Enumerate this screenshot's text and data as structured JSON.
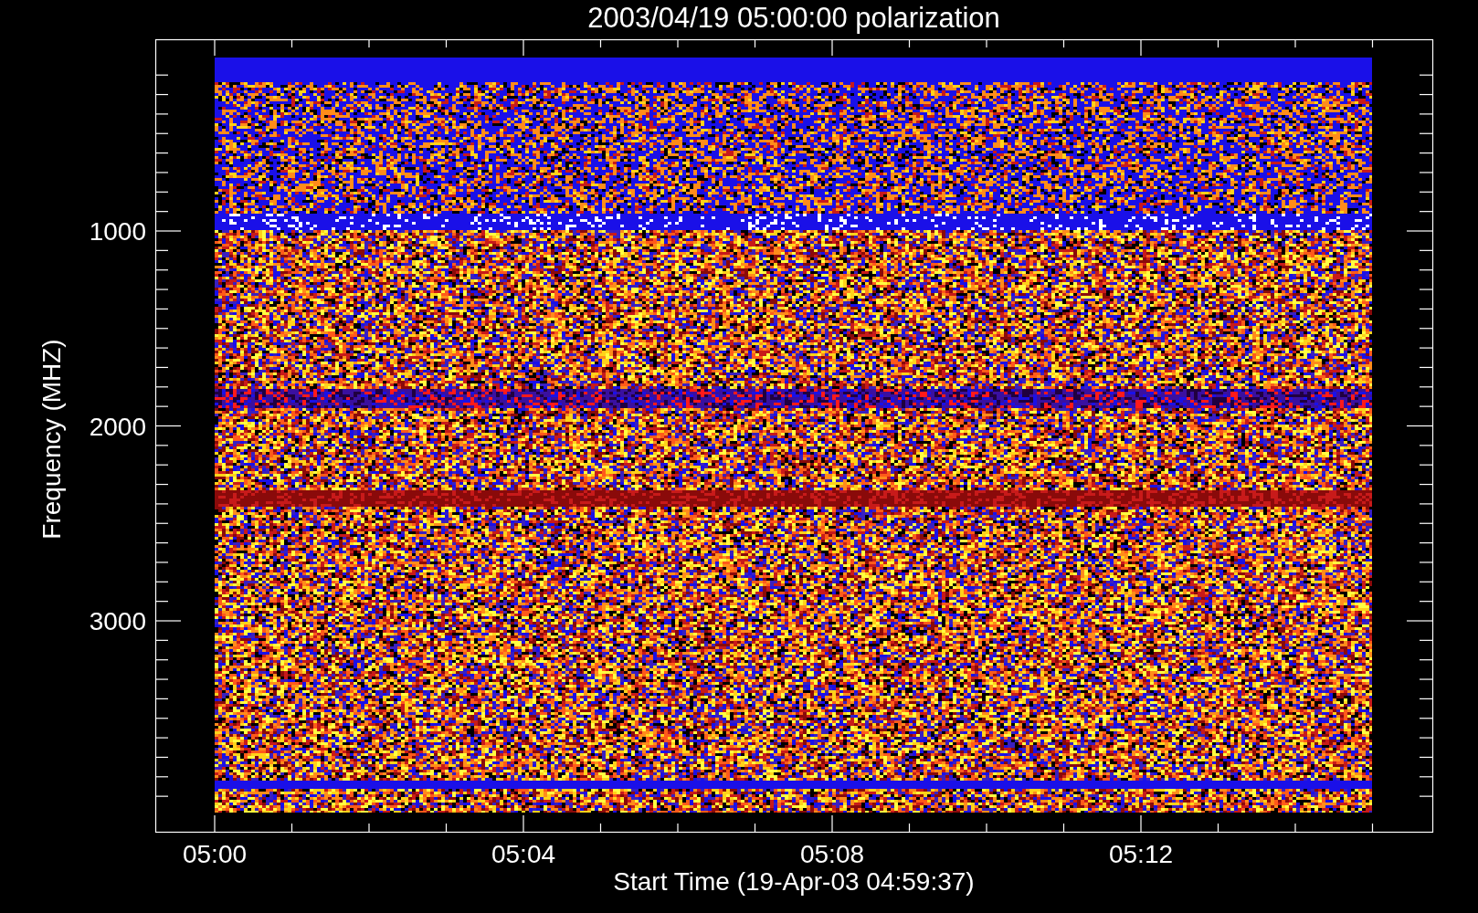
{
  "title": "2003/04/19 05:00:00 polarization",
  "xaxis": {
    "label": "Start Time (19-Apr-03 04:59:37)",
    "ticks": [
      "05:00",
      "05:04",
      "05:08",
      "05:12"
    ]
  },
  "yaxis": {
    "label": "Frequency (MHZ)",
    "ticks": [
      "1000",
      "2000",
      "3000"
    ]
  }
}
